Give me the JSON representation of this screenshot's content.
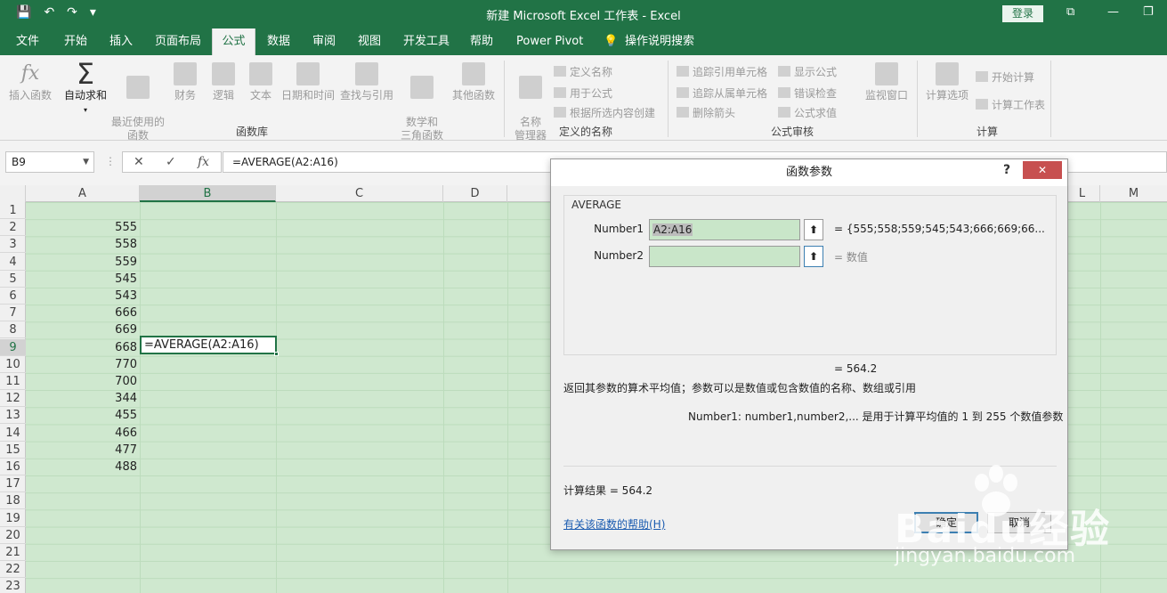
{
  "app": {
    "title": "新建 Microsoft Excel 工作表  -  Excel",
    "login": "登录",
    "qat": [
      "💾",
      "↶",
      "↷",
      "▾"
    ]
  },
  "tabs": [
    "文件",
    "开始",
    "插入",
    "页面布局",
    "公式",
    "数据",
    "审阅",
    "视图",
    "开发工具",
    "帮助",
    "Power Pivot",
    "操作说明搜索"
  ],
  "active_tab": "公式",
  "ribbon": {
    "function_library": {
      "label": "函数库",
      "items": [
        "插入函数",
        "自动求和",
        "最近使用的\n函数",
        "财务",
        "逻辑",
        "文本",
        "日期和时间",
        "查找与引用",
        "数学和\n三角函数",
        "其他函数"
      ]
    },
    "defined_names": {
      "label": "定义的名称",
      "manager": "名称\n管理器",
      "items": [
        "定义名称",
        "用于公式",
        "根据所选内容创建"
      ]
    },
    "formula_auditing": {
      "label": "公式审核",
      "items": [
        "追踪引用单元格",
        "追踪从属单元格",
        "删除箭头",
        "显示公式",
        "错误检查",
        "公式求值"
      ],
      "watch": "监视窗口"
    },
    "calculation": {
      "label": "计算",
      "options": "计算选项",
      "items": [
        "开始计算",
        "计算工作表"
      ]
    }
  },
  "formula_bar": {
    "name_box": "B9",
    "formula": "=AVERAGE(A2:A16)"
  },
  "grid": {
    "columns": [
      "A",
      "B",
      "C",
      "D",
      "L",
      "M"
    ],
    "rows": [
      "1",
      "2",
      "3",
      "4",
      "5",
      "6",
      "7",
      "8",
      "9",
      "10",
      "11",
      "12",
      "13",
      "14",
      "15",
      "16",
      "17",
      "18",
      "19",
      "20",
      "21",
      "22",
      "23"
    ],
    "column_a_values": [
      "",
      "555",
      "558",
      "559",
      "545",
      "543",
      "666",
      "669",
      "668",
      "770",
      "700",
      "344",
      "455",
      "466",
      "477",
      "488"
    ],
    "active_cell_text": "=AVERAGE(A2:A16)"
  },
  "dialog": {
    "title": "函数参数",
    "help": "?",
    "close": "✕",
    "function_name": "AVERAGE",
    "args": [
      {
        "label": "Number1",
        "value": "A2:A16",
        "result": "=  {555;558;559;545;543;666;669;66..."
      },
      {
        "label": "Number2",
        "value": "",
        "result": "=  数值"
      }
    ],
    "formula_result_line": "=   564.2",
    "description": "返回其参数的算术平均值；参数可以是数值或包含数值的名称、数组或引用",
    "arg_help": "Number1:   number1,number2,... 是用于计算平均值的 1 到 255 个数值参数",
    "calc_result": "计算结果 =   564.2",
    "help_link": "有关该函数的帮助(H)",
    "ok": "确定",
    "cancel": "取消"
  },
  "watermark": {
    "brand": "Baidu经验",
    "url": "jingyan.baidu.com"
  }
}
